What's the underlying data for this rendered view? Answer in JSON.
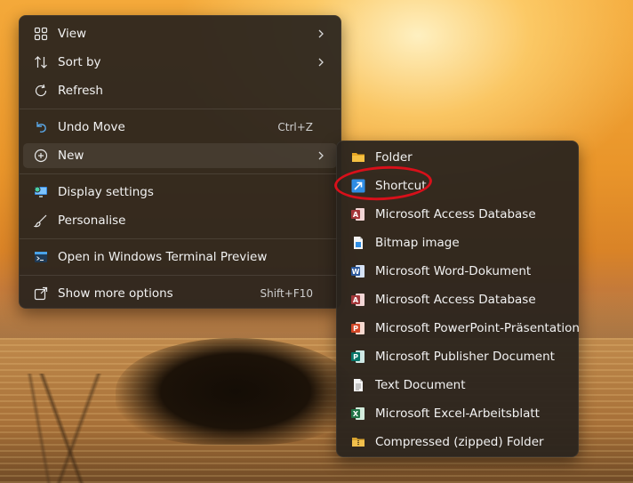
{
  "context_menu": {
    "items": [
      {
        "label": "View",
        "icon": "grid-icon",
        "has_submenu": true
      },
      {
        "label": "Sort by",
        "icon": "sort-icon",
        "has_submenu": true
      },
      {
        "label": "Refresh",
        "icon": "refresh-icon"
      },
      {
        "label": "Undo Move",
        "icon": "undo-icon",
        "shortcut": "Ctrl+Z"
      },
      {
        "label": "New",
        "icon": "plus-circle-icon",
        "has_submenu": true,
        "highlighted": true
      },
      {
        "label": "Display settings",
        "icon": "display-settings-icon"
      },
      {
        "label": "Personalise",
        "icon": "brush-icon"
      },
      {
        "label": "Open in Windows Terminal Preview",
        "icon": "terminal-icon"
      },
      {
        "label": "Show more options",
        "icon": "share-icon",
        "shortcut": "Shift+F10"
      }
    ]
  },
  "new_submenu": {
    "items": [
      {
        "label": "Folder",
        "icon": "folder-icon"
      },
      {
        "label": "Shortcut",
        "icon": "shortcut-icon",
        "annotated": true
      },
      {
        "label": "Microsoft Access Database",
        "icon": "access-icon"
      },
      {
        "label": "Bitmap image",
        "icon": "bitmap-icon"
      },
      {
        "label": "Microsoft Word-Dokument",
        "icon": "word-icon"
      },
      {
        "label": "Microsoft Access Database",
        "icon": "access-icon"
      },
      {
        "label": "Microsoft PowerPoint-Präsentation",
        "icon": "powerpoint-icon"
      },
      {
        "label": "Microsoft Publisher Document",
        "icon": "publisher-icon"
      },
      {
        "label": "Text Document",
        "icon": "text-document-icon"
      },
      {
        "label": "Microsoft Excel-Arbeitsblatt",
        "icon": "excel-icon"
      },
      {
        "label": "Compressed (zipped) Folder",
        "icon": "zip-folder-icon"
      }
    ]
  },
  "colors": {
    "menu_bg": "#2a241e",
    "annotation": "#d8101a",
    "word": "#2b579a",
    "excel": "#217346",
    "powerpoint": "#d24726",
    "access": "#a4373a",
    "publisher": "#077568",
    "folder": "#f5c042"
  }
}
